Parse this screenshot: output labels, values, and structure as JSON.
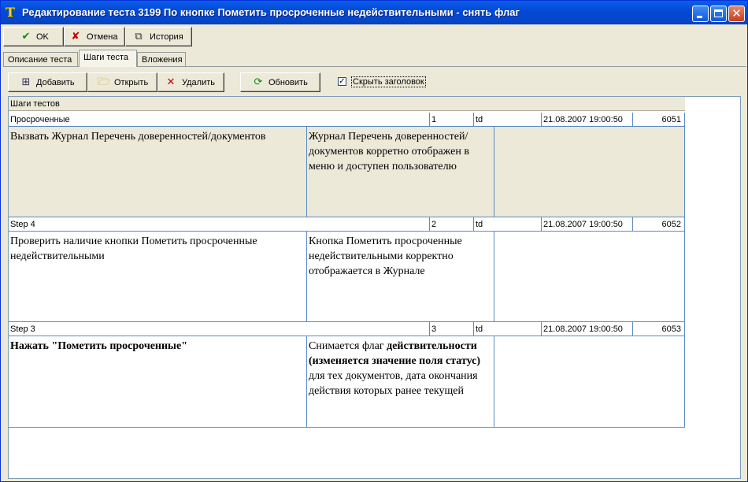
{
  "window": {
    "title": "Редактирование теста 3199 По кнопке  Пометить просроченные недействительными  - снять флаг"
  },
  "toolbar": {
    "ok": "OK",
    "cancel": "Отмена",
    "history": "История"
  },
  "tabs": [
    "Описание теста",
    "Шаги теста",
    "Вложения"
  ],
  "steps_toolbar": {
    "add": "Добавить",
    "open": "Открыть",
    "delete": "Удалить",
    "refresh": "Обновить",
    "hide_header": "Скрыть заголовок",
    "hide_header_checked": true
  },
  "grid": {
    "header": "Шаги тестов",
    "rows": [
      {
        "name": "Просроченные",
        "num": "1",
        "type": "td",
        "date": "21.08.2007 19:00:50",
        "id": "6051",
        "action": "Вызвать Журнал Перечень доверенностей/документов",
        "expected": "Журнал Перечень доверенностей/документов корретно отображен в меню и доступен пользователю",
        "selected": true
      },
      {
        "name": "Step 4",
        "num": "2",
        "type": "td",
        "date": "21.08.2007 19:00:50",
        "id": "6052",
        "action": "Проверить наличие кнопки Пометить просроченные недействительными",
        "expected": "Кнопка Пометить просроченные недействительными корректно отображается в Журнале"
      },
      {
        "name": "Step 3",
        "num": "3",
        "type": "td",
        "date": "21.08.2007 19:00:50",
        "id": "6053",
        "action": "Нажать \"Пометить просроченные\"",
        "expected_pre": "Снимается флаг ",
        "expected_bold": "действительности (изменяется значение поля статус)",
        "expected_post": " для тех документов, дата окончания действия которых ранее текущей"
      }
    ]
  },
  "colors": {
    "title_bar": "#0348d6",
    "grid_line": "#5b8bc4",
    "selected_row": "#ece9d8"
  }
}
